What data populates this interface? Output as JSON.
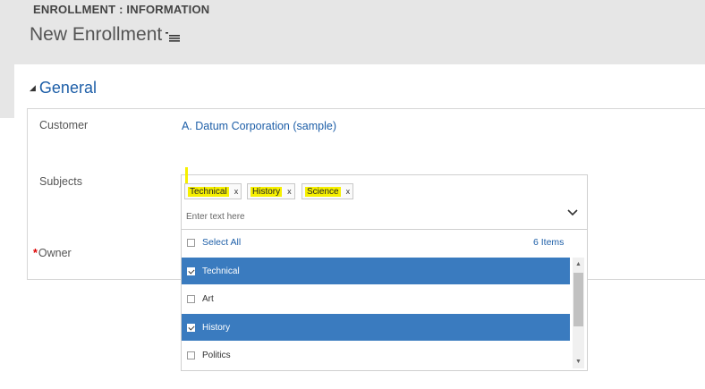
{
  "header": {
    "entity_label": "ENROLLMENT : INFORMATION",
    "record_title": "New Enrollment"
  },
  "section": {
    "title": "General"
  },
  "fields": {
    "customer_label": "Customer",
    "customer_value": "A. Datum Corporation (sample)",
    "subjects_label": "Subjects",
    "owner_required_mark": "*",
    "owner_label": "Owner"
  },
  "multiselect": {
    "tags": [
      {
        "label": "Technical",
        "remove": "x"
      },
      {
        "label": "History",
        "remove": "x"
      },
      {
        "label": "Science",
        "remove": "x"
      }
    ],
    "placeholder": "Enter text here",
    "select_all_label": "Select All",
    "items_count": "6 Items",
    "options": [
      {
        "label": "Technical",
        "checked": true
      },
      {
        "label": "Art",
        "checked": false
      },
      {
        "label": "History",
        "checked": true
      },
      {
        "label": "Politics",
        "checked": false
      }
    ]
  },
  "colors": {
    "accent": "#1e5fa8",
    "selected_row": "#3a7bbf",
    "highlight": "#f6f000",
    "required": "#dd0000"
  }
}
